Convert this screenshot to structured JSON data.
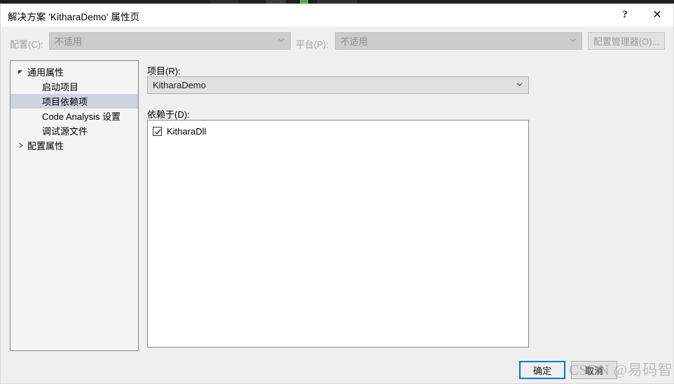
{
  "window": {
    "title": "解决方案 'KitharaDemo' 属性页",
    "help_button": "?",
    "close_button": "✕"
  },
  "toolbar": {
    "config_label": "配置(C):",
    "config_value": "不适用",
    "platform_label": "平台(P):",
    "platform_value": "不适用",
    "config_manager_button": "配置管理器(O)..."
  },
  "tree": {
    "items": [
      {
        "label": "通用属性",
        "level": 0,
        "expander": "collapse",
        "selected": false
      },
      {
        "label": "启动项目",
        "level": 1,
        "expander": "none",
        "selected": false
      },
      {
        "label": "项目依赖项",
        "level": 1,
        "expander": "none",
        "selected": true
      },
      {
        "label": "Code Analysis 设置",
        "level": 1,
        "expander": "none",
        "selected": false
      },
      {
        "label": "调试源文件",
        "level": 1,
        "expander": "none",
        "selected": false
      },
      {
        "label": "配置属性",
        "level": 0,
        "expander": "expand",
        "selected": false
      }
    ]
  },
  "main": {
    "project_label": "项目(R):",
    "project_value": "KitharaDemo",
    "depends_label": "依赖于(D):",
    "depends_items": [
      {
        "label": "KitharaDll",
        "checked": true
      }
    ]
  },
  "footer": {
    "ok_button": "确定",
    "cancel_button": "取消"
  },
  "watermark": {
    "text": "CSDN @易码智能"
  },
  "colors": {
    "accent": "#0078d7",
    "dialog_bg": "#efefef",
    "titlebar_bg": "#ffffff",
    "panel_bg": "#f4f4f4",
    "listbox_bg": "#ffffff",
    "tree_selection": "#cdd3e1",
    "control_border": "#828790",
    "disabled_text": "#9a9a9a",
    "strip": "#1e1e1e"
  }
}
